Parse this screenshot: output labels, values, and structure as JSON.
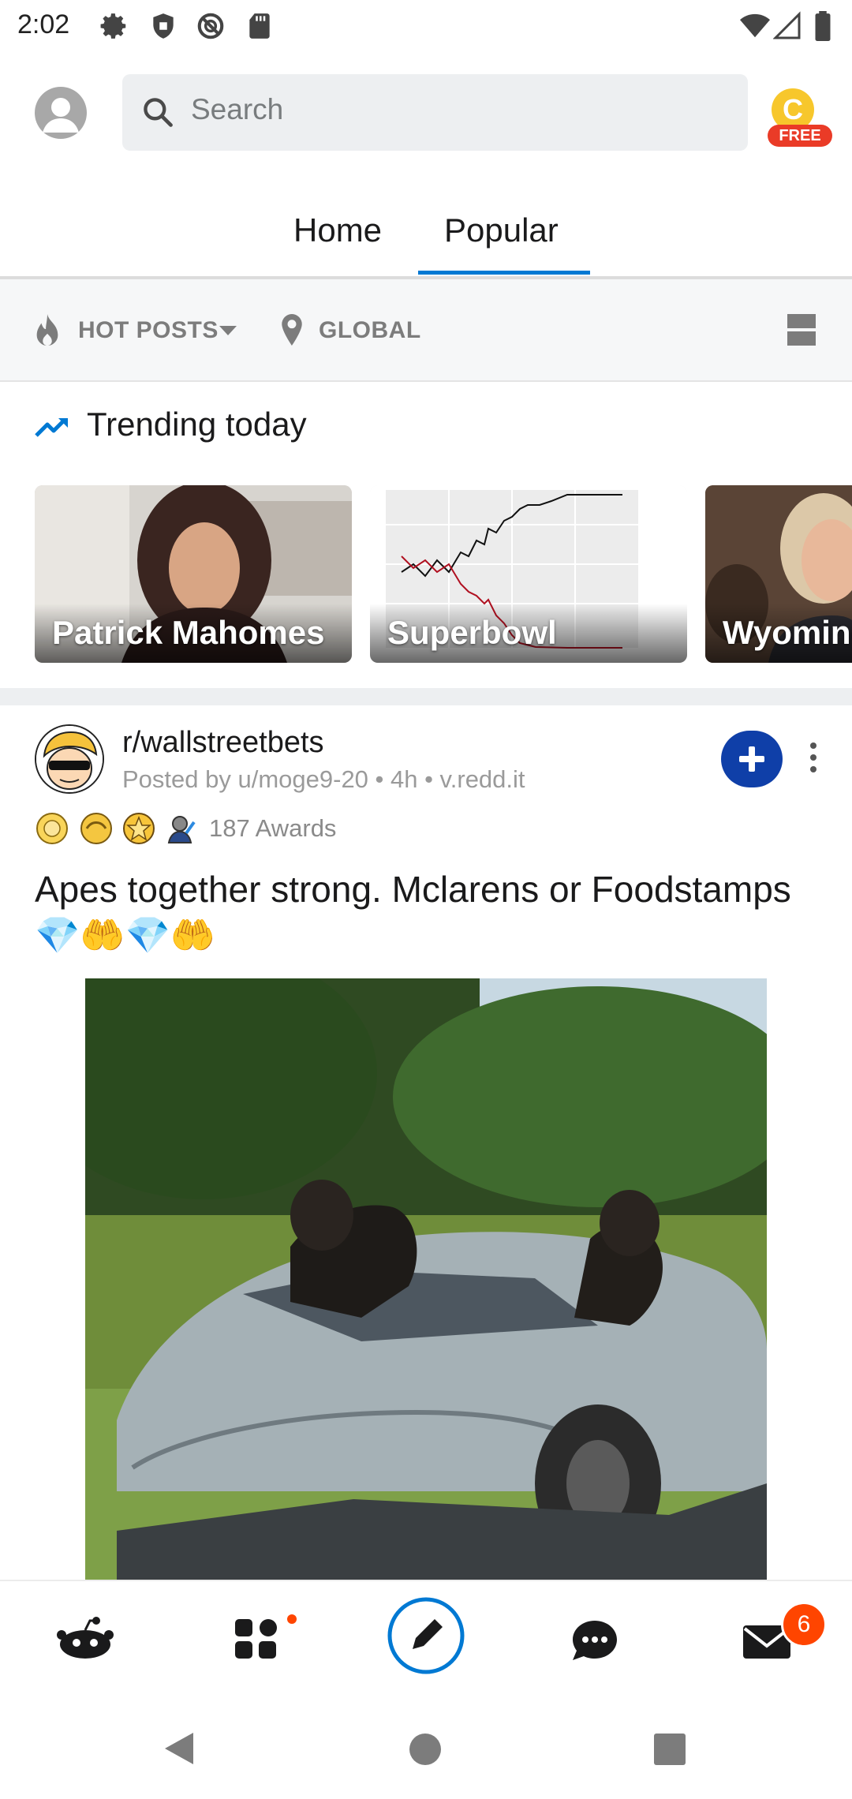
{
  "status_bar": {
    "time": "2:02"
  },
  "header": {
    "search_placeholder": "Search",
    "coin_badge": "FREE",
    "coin_letter": "C"
  },
  "tabs": [
    {
      "label": "Home",
      "selected": false
    },
    {
      "label": "Popular",
      "selected": true
    }
  ],
  "filters": {
    "sort_label": "HOT POSTS",
    "location_label": "GLOBAL"
  },
  "trending": {
    "title": "Trending today",
    "cards": [
      {
        "label": "Patrick Mahomes"
      },
      {
        "label": "Superbowl"
      },
      {
        "label": "Wyoming"
      }
    ]
  },
  "post": {
    "subreddit": "r/wallstreetbets",
    "meta": "Posted by u/moge9-20 • 4h • v.redd.it",
    "awards_count": "187 Awards",
    "title": "Apes together strong. Mclarens or Foodstamps 💎🤲💎🤲"
  },
  "bottom_nav": {
    "inbox_badge": "6"
  },
  "colors": {
    "accent_blue": "#0079d3",
    "join_button": "#0f3fa8",
    "badge_orange": "#ff4500",
    "free_red": "#ea3b27"
  }
}
